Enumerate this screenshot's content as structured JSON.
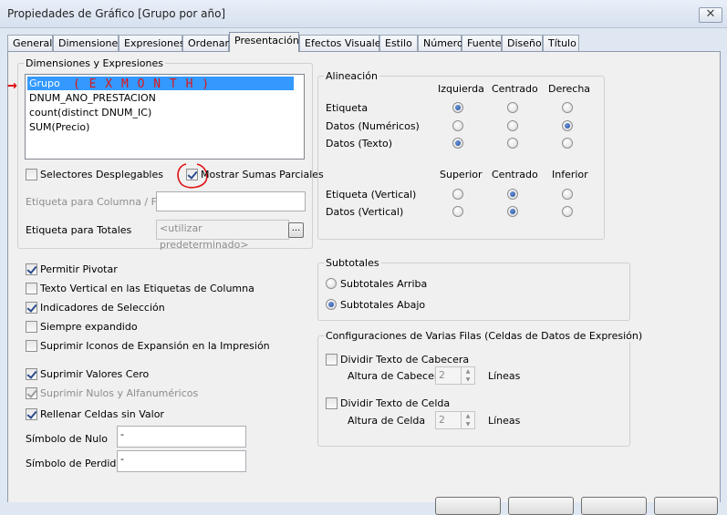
{
  "window": {
    "title": "Propiedades de Gráfico [Grupo por año]",
    "close_glyph": "✕"
  },
  "tabs": [
    "General",
    "Dimensiones",
    "Expresiones",
    "Ordenar",
    "Presentación",
    "Efectos Visuales",
    "Estilo",
    "Número",
    "Fuente",
    "Diseño",
    "Título"
  ],
  "active_tab": "Presentación",
  "dim_expr": {
    "legend": "Dimensiones y Expresiones",
    "items": [
      "Grupo",
      "DNUM_ANO_PRESTACION",
      "count(distinct DNUM_IC)",
      "SUM(Precio)"
    ],
    "selected_index": 0
  },
  "annotations": {
    "arrow": "→",
    "note": "( E X   M O N T H )"
  },
  "selectores_desplegables": {
    "label": "Selectores Desplegables",
    "checked": false
  },
  "mostrar_sumas_parciales": {
    "label": "Mostrar Sumas Parciales",
    "checked": true
  },
  "etiqueta_columna_fila": {
    "label": "Etiqueta para Columna / Fila",
    "value": ""
  },
  "etiqueta_totales": {
    "label": "Etiqueta para Totales",
    "placeholder": "<utilizar predeterminado>",
    "button": "..."
  },
  "alineacion": {
    "legend": "Alineación",
    "h_headers": [
      "Izquierda",
      "Centrado",
      "Derecha"
    ],
    "h_rows": [
      {
        "label": "Etiqueta",
        "selected": 0
      },
      {
        "label": "Datos (Numéricos)",
        "selected": 2
      },
      {
        "label": "Datos (Texto)",
        "selected": 0
      }
    ],
    "v_headers": [
      "Superior",
      "Centrado",
      "Inferior"
    ],
    "v_rows": [
      {
        "label": "Etiqueta (Vertical)",
        "selected": 1
      },
      {
        "label": "Datos (Vertical)",
        "selected": 1
      }
    ]
  },
  "checkboxes": [
    {
      "label": "Permitir Pivotar",
      "checked": true,
      "disabled": false
    },
    {
      "label": "Texto Vertical en las Etiquetas de Columna",
      "checked": false,
      "disabled": false
    },
    {
      "label": "Indicadores de Selección",
      "checked": true,
      "disabled": false
    },
    {
      "label": "Siempre expandido",
      "checked": false,
      "disabled": false
    },
    {
      "label": "Suprimir Iconos de Expansión en la Impresión",
      "checked": false,
      "disabled": false
    },
    {
      "label": "Suprimir Valores Cero",
      "checked": true,
      "disabled": false
    },
    {
      "label": "Suprimir Nulos y Alfanuméricos",
      "checked": true,
      "disabled": true
    },
    {
      "label": "Rellenar Celdas sin Valor",
      "checked": true,
      "disabled": false
    }
  ],
  "simbolo_nulo": {
    "label": "Símbolo de Nulo",
    "value": "-"
  },
  "simbolo_perdido": {
    "label": "Símbolo de Perdido",
    "value": "-"
  },
  "subtotales": {
    "legend": "Subtotales",
    "options": [
      "Subtotales Arriba",
      "Subtotales Abajo"
    ],
    "selected": 1
  },
  "varias_filas": {
    "legend": "Configuraciones de Varias Filas (Celdas de Datos de Expresión)",
    "dividir_cabecera": {
      "label": "Dividir Texto de Cabecera",
      "checked": false
    },
    "altura_cabecera": {
      "label": "Altura de Cabecera",
      "value": "2",
      "unit": "Líneas"
    },
    "dividir_celda": {
      "label": "Dividir Texto de Celda",
      "checked": false
    },
    "altura_celda": {
      "label": "Altura de Celda",
      "value": "2",
      "unit": "Líneas"
    }
  }
}
